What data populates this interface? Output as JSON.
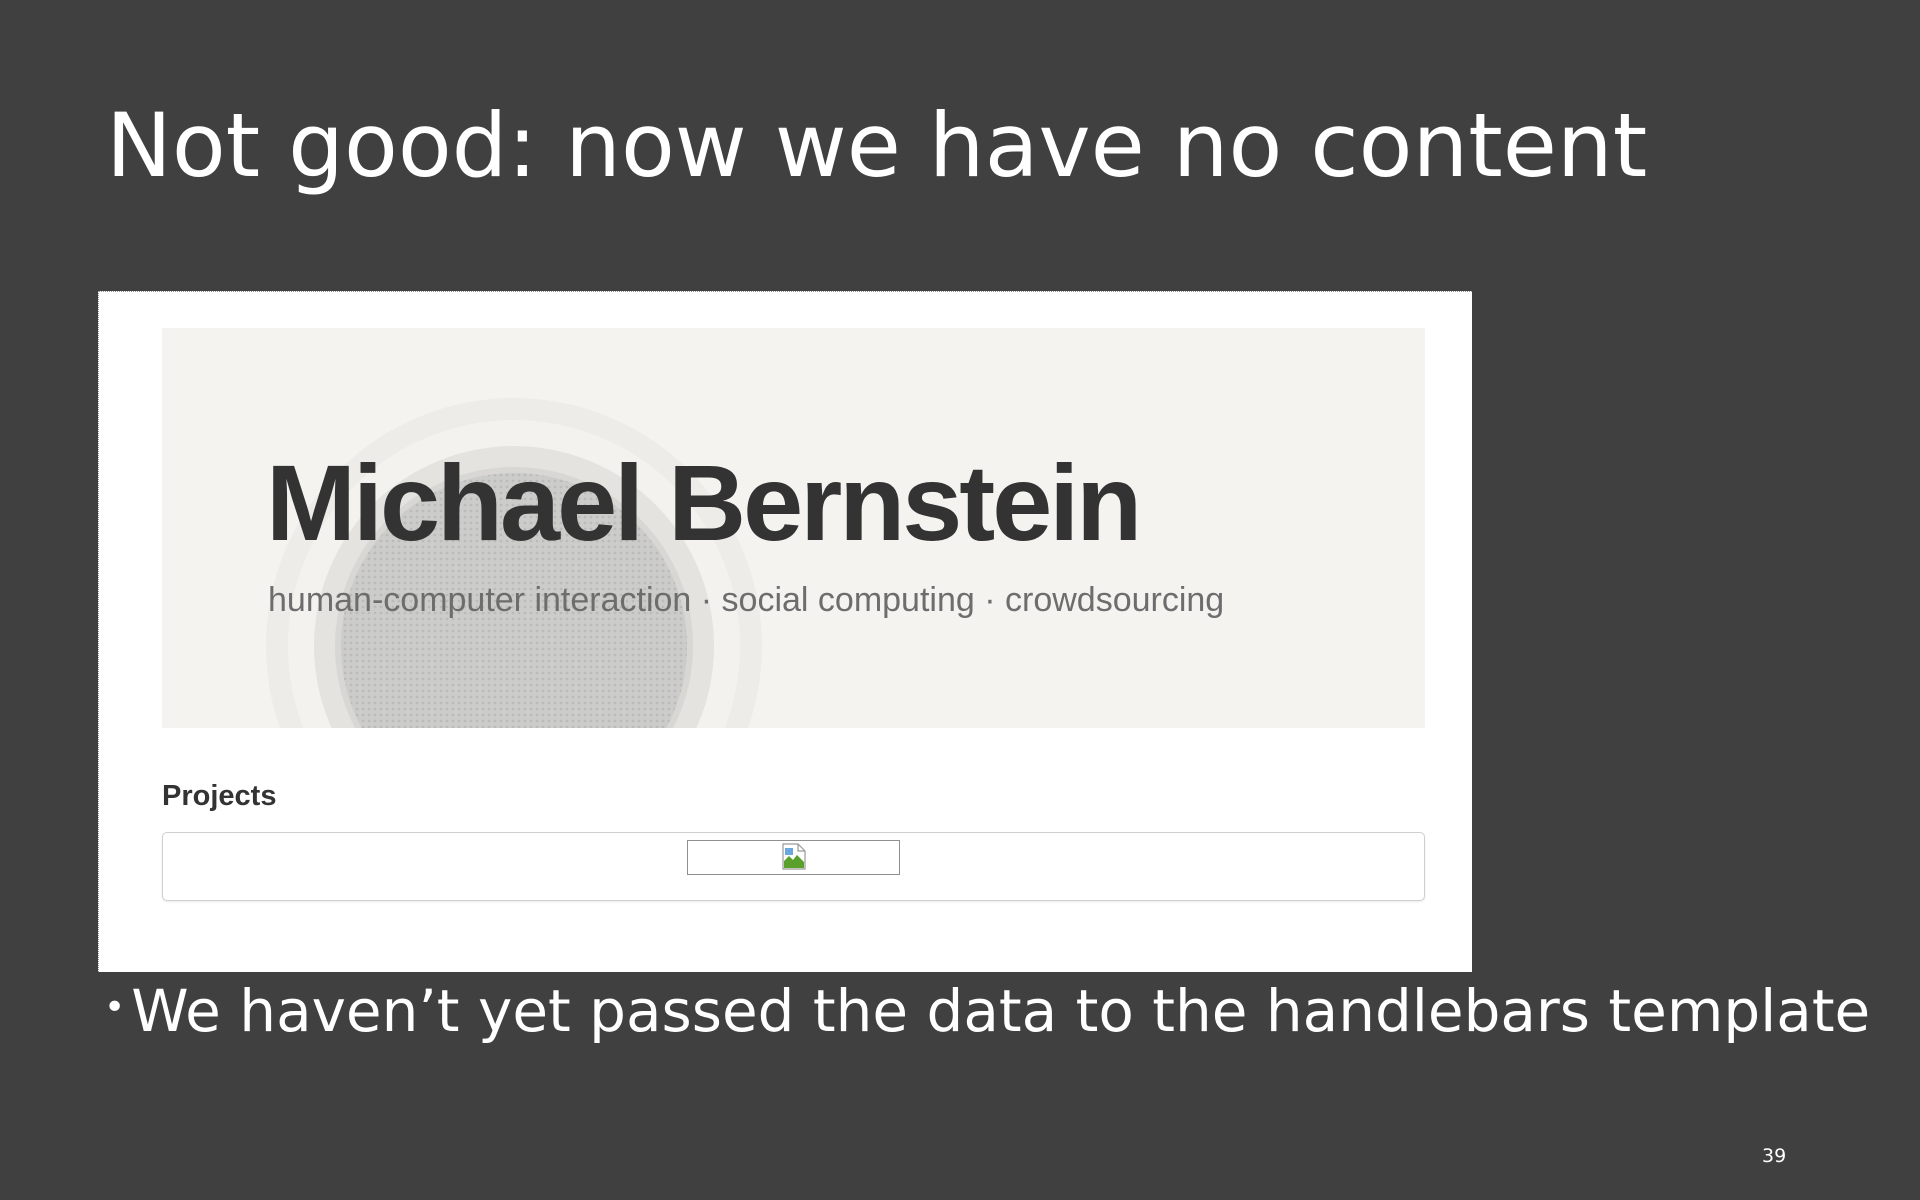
{
  "slide": {
    "title": "Not good: now we have no content",
    "bullet": "We haven’t yet passed the data to the handlebars template",
    "bullet_marker": "•",
    "page_number": "39"
  },
  "screenshot": {
    "hero": {
      "name": "Michael Bernstein",
      "tagline": "human-computer interaction · social computing · crowdsourcing"
    },
    "projects": {
      "heading": "Projects",
      "image_icon": "broken-image-icon"
    }
  },
  "colors": {
    "slide_background": "#404040",
    "slide_text": "#ffffff",
    "page_background": "#ffffff",
    "hero_background": "#f4f3f0",
    "name_text": "#333333",
    "tagline_text": "#6d6d6d"
  }
}
